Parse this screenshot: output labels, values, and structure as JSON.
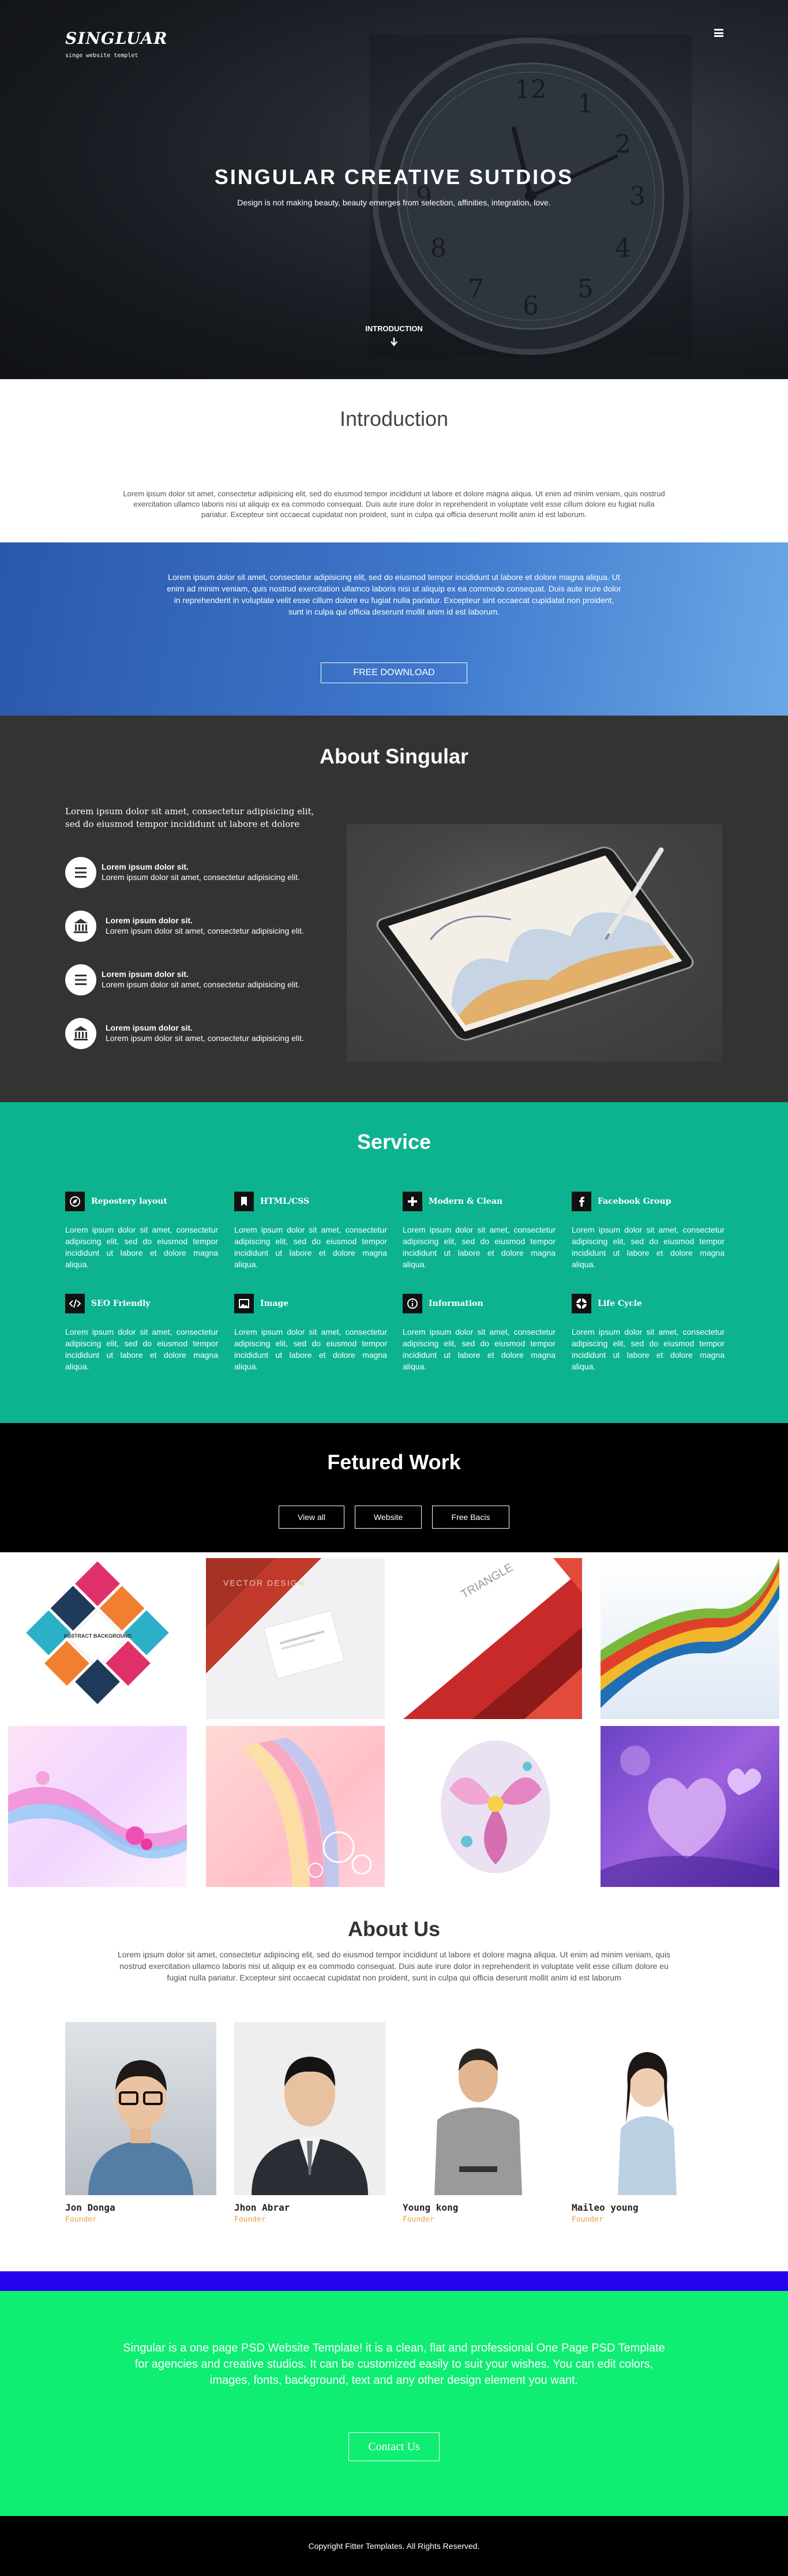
{
  "hero": {
    "brand": "SINGLUAR",
    "tagline": "singe website templet",
    "title": "SINGULAR CREATIVE SUTDIOS",
    "subtitle": "Design is not making beauty, beauty emerges from selection, affinities, integration, love.",
    "intro_link": "INTRODUCTION"
  },
  "introduction": {
    "heading": "Introduction",
    "text": "Lorem ipsum dolor sit amet, consectetur adipisicing elit, sed do eiusmod tempor incididunt ut labore et dolore magna aliqua. Ut enim ad minim veniam, quis nostrud exercitation ullamco laboris nisi ut aliquip ex ea commodo consequat. Duis aute irure dolor in reprehenderit in voluptate velit esse cillum dolore eu fugiat nulla pariatur. Excepteur sint occaecat cupidatat non proident, sunt in culpa qui officia deserunt mollit anim id est laborum."
  },
  "banner": {
    "text": "Lorem ipsum dolor sit amet, consectetur adipisicing elit, sed do eiusmod tempor incididunt ut labore et dolore magna aliqua. Ut enim ad minim veniam, quis nostrud exercitation ullamco laboris nisi ut aliquip ex ea commodo consequat. Duis aute irure dolor in reprehenderit in voluptate velit esse cillum dolore eu fugiat nulla pariatur. Excepteur sint occaecat cupidatat non proident, sunt in culpa qui officia deserunt mollit anim id est laborum.",
    "button": "FREE DOWNLOAD",
    "gradient": [
      "#2a58aa",
      "#6ba8e6"
    ]
  },
  "about": {
    "heading": "About Singular",
    "lead": "Lorem ipsum dolor sit amet, consectetur adipisicing elit, sed do eiusmod tempor incididunt ut labore et dolore",
    "features": [
      {
        "icon": "menu-icon",
        "title": "Lorem ipsum dolor sit.",
        "text": "Lorem ipsum dolor sit amet, consectetur adipisicing elit."
      },
      {
        "icon": "bank-icon",
        "title": "Lorem ipsum dolor sit.",
        "text": "Lorem ipsum dolor sit amet, consectetur adipisicing elit."
      },
      {
        "icon": "menu-icon",
        "title": "Lorem ipsum dolor sit.",
        "text": "Lorem ipsum dolor sit amet, consectetur adipisicing elit."
      },
      {
        "icon": "bank-icon",
        "title": "Lorem ipsum dolor sit.",
        "text": "Lorem ipsum dolor sit amet, consectetur adipisicing elit."
      }
    ]
  },
  "service": {
    "heading": "Service",
    "color": "#0db38f",
    "items": [
      {
        "icon": "compass-icon",
        "title": "Repostery layout",
        "text": "Lorem ipsum dolor sit amet, consectetur adipiscing elit, sed do eiusmod tempor incididunt ut labore et dolore magna aliqua."
      },
      {
        "icon": "bookmark-icon",
        "title": "HTML/CSS",
        "text": "Lorem ipsum dolor sit amet, consectetur adipiscing elit, sed do eiusmod tempor incididunt ut labore et dolore magna aliqua."
      },
      {
        "icon": "plus-icon",
        "title": "Modern & Clean",
        "text": "Lorem ipsum dolor sit amet, consectetur adipiscing elit, sed do eiusmod tempor incididunt ut labore et dolore magna aliqua."
      },
      {
        "icon": "facebook-icon",
        "title": "Facebook Group",
        "text": "Lorem ipsum dolor sit amet, consectetur adipiscing elit, sed do eiusmod tempor incididunt ut labore et dolore magna aliqua."
      },
      {
        "icon": "code-icon",
        "title": "SEO Friendly",
        "text": "Lorem ipsum dolor sit amet, consectetur adipiscing elit, sed do eiusmod tempor incididunt ut labore et dolore magna aliqua."
      },
      {
        "icon": "image-icon",
        "title": "Image",
        "text": "Lorem ipsum dolor sit amet, consectetur adipiscing elit, sed do eiusmod tempor incididunt ut labore et dolore magna aliqua."
      },
      {
        "icon": "info-icon",
        "title": "Information",
        "text": "Lorem ipsum dolor sit amet, consectetur adipiscing elit, sed do eiusmod tempor incididunt ut labore et dolore magna aliqua."
      },
      {
        "icon": "lifebuoy-icon",
        "title": "Life Cycle",
        "text": "Lorem ipsum dolor sit amet, consectetur adipiscing elit, sed do eiusmod tempor incididunt ut labore et dolore magna aliqua."
      }
    ]
  },
  "work": {
    "heading": "Fetured Work",
    "filters": [
      "View all",
      "Website",
      "Free Bacis"
    ],
    "tile1_text": "ABSTRACT BACKGROUND",
    "tile2_text": "VECTOR DESIGN",
    "tile3_text": "TRIANGLE"
  },
  "about_us": {
    "heading": "About Us",
    "text": "Lorem ipsum dolor sit amet, consectetur adipiscing elit, sed do eiusmod tempor incididunt ut labore et dolore magna aliqua. Ut enim ad minim veniam, quis nostrud exercitation ullamco laboris nisi ut aliquip ex ea commodo consequat. Duis aute irure dolor in reprehenderit in voluptate velit esse cillum dolore eu fugiat nulla pariatur. Excepteur sint occaecat cupidatat non proident, sunt in culpa qui officia deserunt mollit anim id est laborum",
    "members": [
      {
        "name": "Jon Donga",
        "role": "Founder"
      },
      {
        "name": "Jhon Abrar",
        "role": "Founder"
      },
      {
        "name": "Young kong",
        "role": "Founder"
      },
      {
        "name": "Maileo young",
        "role": "Founder"
      }
    ]
  },
  "cta": {
    "text": "Singular is a one page PSD Website Template! it is a clean, flat and professional One Page PSD Template for agencies and creative studios. It can be customized easily to suit your wishes. You can edit colors, images, fonts, background, text and any other design element you want.",
    "button": "Contact Us",
    "color": "#0fed73",
    "bar_color": "#2503ee"
  },
  "footer": {
    "text": "Copyright Fitter Templates. All Rights Reserved."
  }
}
